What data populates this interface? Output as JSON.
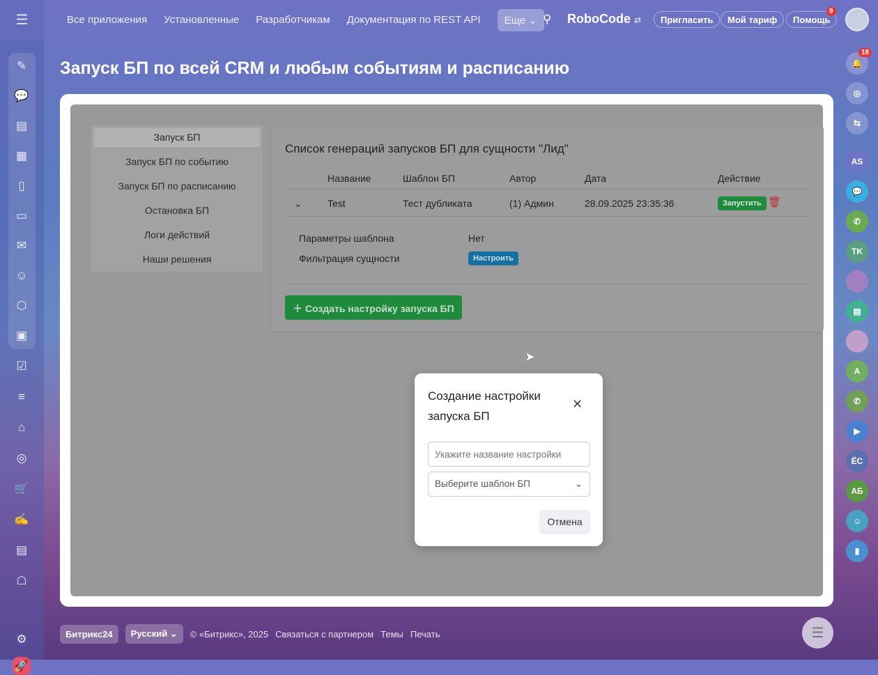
{
  "topbar": {
    "nav": [
      "Все приложения",
      "Установленные",
      "Разработчикам",
      "Документация по REST API"
    ],
    "more": "Еще",
    "brand": "RoboCode",
    "invite": "Пригласить",
    "tariff": "Мой тариф",
    "help": "Помощь",
    "help_badge": "9"
  },
  "page_title": "Запуск БП по всей CRM и любым событиям и расписанию",
  "menu": [
    "Запуск БП",
    "Запуск БП по событию",
    "Запуск БП по расписанию",
    "Остановка БП",
    "Логи действий",
    "Наши решения"
  ],
  "panel": {
    "title": "Список генераций запусков БП для сущности \"Лид\"",
    "columns": [
      "Название",
      "Шаблон БП",
      "Автор",
      "Дата",
      "Действие"
    ],
    "rows": [
      {
        "name": "Test",
        "template": "Тест дубликата",
        "author": "(1) Админ",
        "date": "28.09.2025 23:35:36",
        "run": "Запустить"
      }
    ],
    "details": {
      "params_label": "Параметры шаблона",
      "params_value": "Нет",
      "filter_label": "Фильтрация сущности",
      "filter_button": "Настроить"
    },
    "create_button": "Создать настройку запуска БП"
  },
  "modal": {
    "title": "Создание настройки запуска БП",
    "name_placeholder": "Укажите название настройки",
    "template_placeholder": "Выберите шаблон БП",
    "cancel": "Отмена"
  },
  "rightbar": {
    "notifications_badge": "18",
    "avatars": [
      "AS",
      "TK",
      "A",
      "ЁС",
      "АБ"
    ]
  },
  "footer": {
    "bitrix": "Битрикс24",
    "language": "Русский",
    "copyright": "© «Битрикс», 2025",
    "partner": "Связаться с партнером",
    "themes": "Темы",
    "print": "Печать"
  },
  "colors": {
    "success": "#1d8a3c",
    "primary": "#1570a0",
    "danger": "#b83030"
  }
}
